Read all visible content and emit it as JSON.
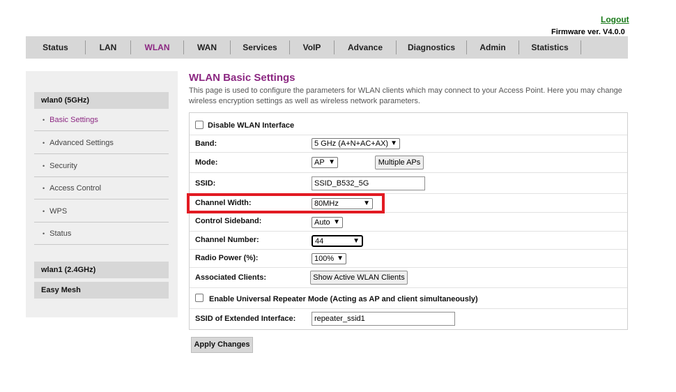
{
  "header": {
    "logout": "Logout",
    "firmware": "Firmware ver. V4.0.0"
  },
  "nav": {
    "tabs": [
      {
        "label": "Status"
      },
      {
        "label": "LAN"
      },
      {
        "label": "WLAN",
        "active": true
      },
      {
        "label": "WAN"
      },
      {
        "label": "Services"
      },
      {
        "label": "VoIP"
      },
      {
        "label": "Advance"
      },
      {
        "label": "Diagnostics"
      },
      {
        "label": "Admin"
      },
      {
        "label": "Statistics"
      }
    ]
  },
  "sidebar": {
    "group_wlan0": "wlan0 (5GHz)",
    "items": [
      {
        "label": "Basic Settings",
        "active": true
      },
      {
        "label": "Advanced Settings"
      },
      {
        "label": "Security"
      },
      {
        "label": "Access Control"
      },
      {
        "label": "WPS"
      },
      {
        "label": "Status"
      }
    ],
    "group_wlan1": "wlan1 (2.4GHz)",
    "group_easymesh": "Easy Mesh"
  },
  "main": {
    "title": "WLAN Basic Settings",
    "description": "This page is used to configure the parameters for WLAN clients which may connect to your Access Point. Here you may change wireless encryption settings as well as wireless network parameters.",
    "disable_wlan_label": "Disable WLAN Interface",
    "disable_wlan_checked": false,
    "band_label": "Band:",
    "band_value": "5 GHz (A+N+AC+AX)",
    "mode_label": "Mode:",
    "mode_value": "AP",
    "multiple_aps_button": "Multiple APs",
    "ssid_label": "SSID:",
    "ssid_value": "SSID_B532_5G",
    "channel_width_label": "Channel Width:",
    "channel_width_value": "80MHz",
    "control_sideband_label": "Control Sideband:",
    "control_sideband_value": "Auto",
    "channel_number_label": "Channel Number:",
    "channel_number_value": "44",
    "radio_power_label": "Radio Power (%):",
    "radio_power_value": "100%",
    "associated_clients_label": "Associated Clients:",
    "show_clients_button": "Show Active WLAN Clients",
    "repeater_label": "Enable Universal Repeater Mode (Acting as AP and client simultaneously)",
    "repeater_checked": false,
    "ssid_extended_label": "SSID of Extended Interface:",
    "ssid_extended_value": "repeater_ssid1",
    "apply_button": "Apply Changes"
  },
  "colors": {
    "accent": "#8c2882",
    "highlight": "#e21b23",
    "logout": "#1a7a1a",
    "nav_bg": "#d7d7d7",
    "sidebar_bg": "#efefef"
  }
}
